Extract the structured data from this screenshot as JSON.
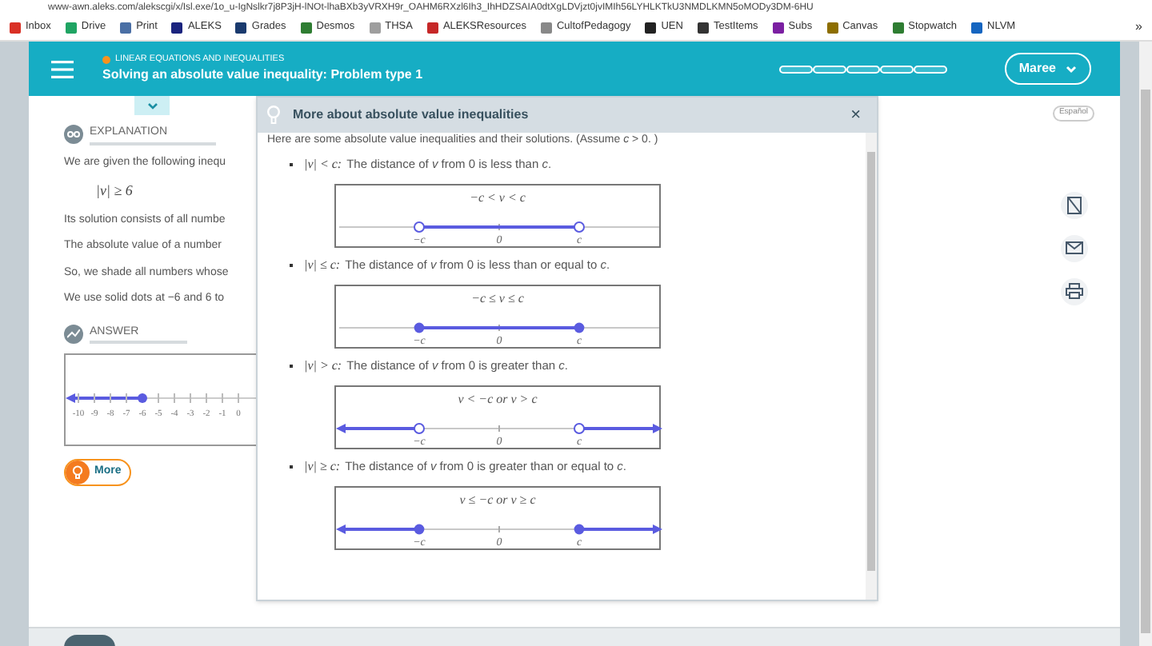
{
  "browser": {
    "url": "www-awn.aleks.com/alekscgi/x/Isl.exe/1o_u-IgNslkr7j8P3jH-lNOt-lhaBXb3yVRXH9r_OAHM6RXzl6Ih3_IhHDZSAIA0dtXgLDVjzt0jvIMIh56LYHLKTkU3NMDLKMN5oMODy3DM-6HU",
    "bookmarks": [
      {
        "label": "Inbox",
        "color": "#d93025"
      },
      {
        "label": "Drive",
        "color": "#1fa463"
      },
      {
        "label": "Print",
        "color": "#4a6fa5"
      },
      {
        "label": "ALEKS",
        "color": "#1a237e"
      },
      {
        "label": "Grades",
        "color": "#1a3a6e"
      },
      {
        "label": "Desmos",
        "color": "#2e7d32"
      },
      {
        "label": "THSA",
        "color": "#9e9e9e"
      },
      {
        "label": "ALEKSResources",
        "color": "#c62828"
      },
      {
        "label": "CultofPedagogy",
        "color": "#888888"
      },
      {
        "label": "UEN",
        "color": "#222222"
      },
      {
        "label": "TestItems",
        "color": "#333333"
      },
      {
        "label": "Subs",
        "color": "#7b1fa2"
      },
      {
        "label": "Canvas",
        "color": "#8d6e00"
      },
      {
        "label": "Stopwatch",
        "color": "#2e7d32"
      },
      {
        "label": "NLVM",
        "color": "#1565c0"
      }
    ],
    "more": "»"
  },
  "header": {
    "topic": "LINEAR EQUATIONS AND INEQUALITIES",
    "title": "Solving an absolute value inequality: Problem type 1",
    "progress": [
      {
        "filled": false
      },
      {
        "filled": false
      },
      {
        "filled": false
      },
      {
        "filled": false
      },
      {
        "filled": false
      }
    ],
    "user": "Maree"
  },
  "language": "Español",
  "explanation": {
    "heading": "EXPLANATION",
    "lines": [
      {
        "kind": "text",
        "text": "We are given the following inequ"
      },
      {
        "kind": "math",
        "text": "|v| ≥ 6"
      },
      {
        "kind": "text",
        "text": "Its solution consists of all numbe"
      },
      {
        "kind": "text",
        "text": "The absolute value of a number"
      },
      {
        "kind": "text",
        "text": "So, we shade all numbers whose"
      },
      {
        "kind": "text",
        "text": "We use solid dots at −6 and 6 to"
      }
    ]
  },
  "answer": {
    "heading": "ANSWER",
    "ticks": [
      {
        "label": "-10",
        "dot": false
      },
      {
        "label": "-9",
        "dot": false
      },
      {
        "label": "-8",
        "dot": false
      },
      {
        "label": "-7",
        "dot": false
      },
      {
        "label": "-6",
        "dot": true
      },
      {
        "label": "-5",
        "dot": false
      },
      {
        "label": "-4",
        "dot": false
      },
      {
        "label": "-3",
        "dot": false
      },
      {
        "label": "-2",
        "dot": false
      },
      {
        "label": "-1",
        "dot": false
      },
      {
        "label": "0",
        "dot": false
      }
    ]
  },
  "more_button": "More",
  "dialog": {
    "title": "More about absolute value inequalities",
    "close": "×",
    "intro": "Here are some absolute value inequalities and their solutions. (Assume *c* > 0. )",
    "items": [
      {
        "condition": "|v| < c:",
        "description": "The distance of *v* from 0 is less than *c*.",
        "line": {
          "label": "−c < v < c",
          "ticks": [
            "−c",
            "0",
            "c"
          ],
          "shade_outside": false,
          "endpoints_filled": false
        }
      },
      {
        "condition": "|v| ≤ c:",
        "description": "The distance of *v* from 0 is less than or equal to *c*.",
        "line": {
          "label": "−c ≤ v ≤ c",
          "ticks": [
            "−c",
            "0",
            "c"
          ],
          "shade_outside": false,
          "endpoints_filled": true
        }
      },
      {
        "condition": "|v| > c:",
        "description": "The distance of *v* from 0 is greater than *c*.",
        "line": {
          "label": "v < −c or v > c",
          "ticks": [
            "−c",
            "0",
            "c"
          ],
          "shade_outside": true,
          "endpoints_filled": false
        }
      },
      {
        "condition": "|v| ≥ c:",
        "description": "The distance of *v* from 0 is greater than or equal to *c*.",
        "line": {
          "label": "v ≤ −c or v ≥ c",
          "ticks": [
            "−c",
            "0",
            "c"
          ],
          "shade_outside": true,
          "endpoints_filled": true
        }
      }
    ]
  }
}
